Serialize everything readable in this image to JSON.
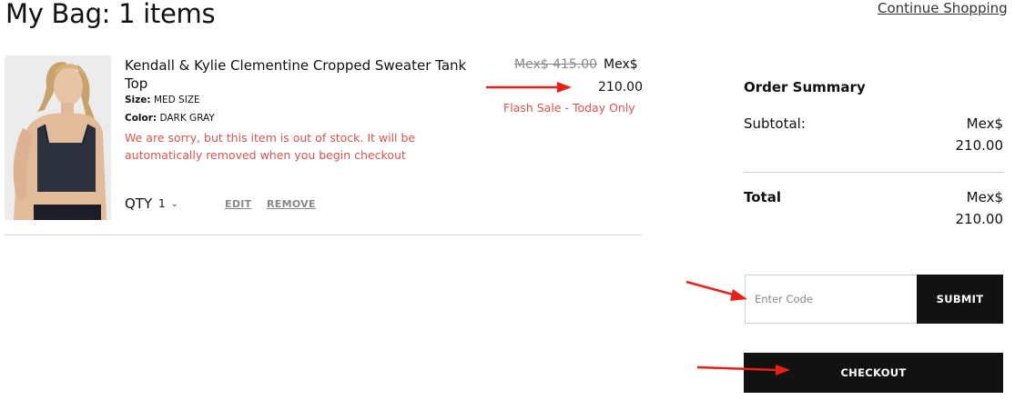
{
  "header": {
    "title": "My Bag: 1 items",
    "continue_label": "Continue Shopping"
  },
  "cart": {
    "item": {
      "name": "Kendall & Kylie Clementine Cropped Sweater Tank Top",
      "size_label": "Size:",
      "size_value": "MED SIZE",
      "color_label": "Color:",
      "color_value": "DARK GRAY",
      "out_of_stock_message": "We are sorry, but this item is out of stock. It will be automatically removed when you begin checkout",
      "original_price": "Mex$ 415.00",
      "price_currency": "Mex$",
      "price_value": "210.00",
      "flash_sale": "Flash Sale - Today Only",
      "qty_label": "QTY",
      "qty_value": "1",
      "edit_label": "EDIT",
      "remove_label": "REMOVE"
    }
  },
  "summary": {
    "title": "Order Summary",
    "subtotal_label": "Subtotal:",
    "subtotal_currency": "Mex$",
    "subtotal_value": "210.00",
    "total_label": "Total",
    "total_currency": "Mex$",
    "total_value": "210.00",
    "promo_placeholder": "Enter Code",
    "submit_label": "SUBMIT",
    "checkout_label": "CHECKOUT"
  },
  "icons": {
    "qty_dropdown": "chevron-down-icon",
    "annotation": "red-arrow-icon"
  },
  "colors": {
    "accent_red": "#d9534f",
    "button_dark": "#121212",
    "muted_gray": "#888888"
  }
}
